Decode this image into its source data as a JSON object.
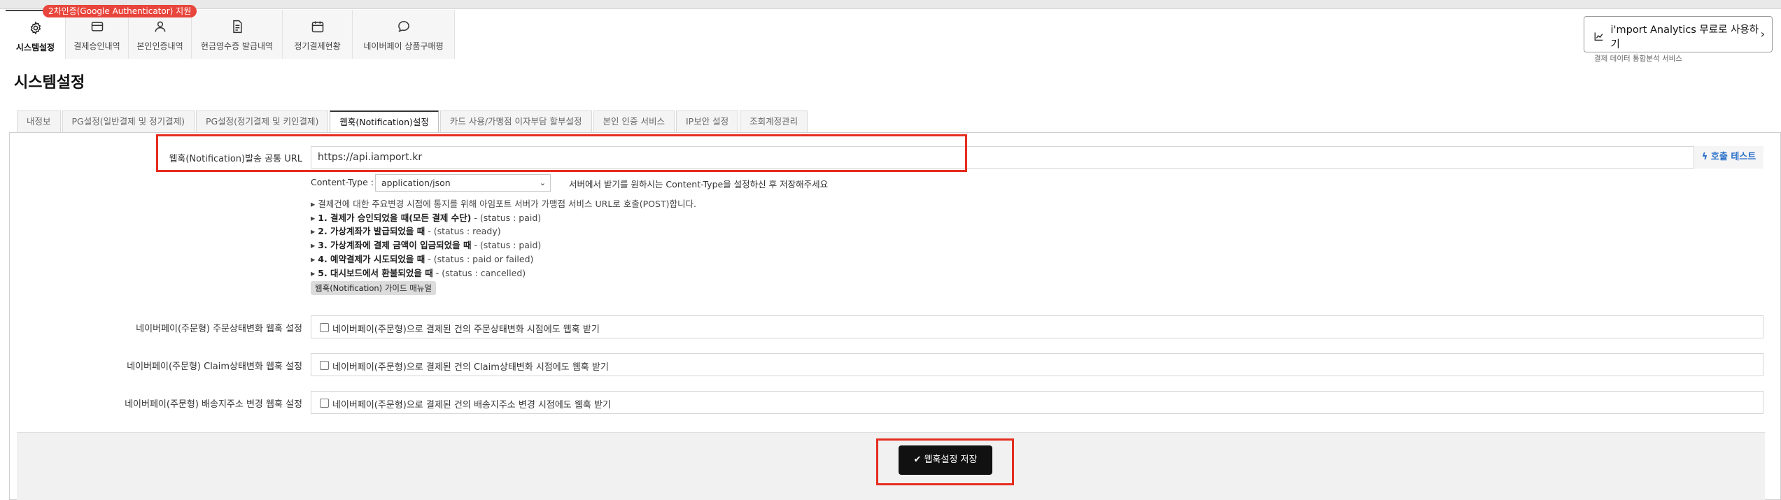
{
  "badge": "2차인증(Google Authenticator) 지원",
  "nav": [
    {
      "icon": "gear-icon",
      "label": "시스템설정",
      "active": true
    },
    {
      "icon": "card-icon",
      "label": "결제승인내역",
      "active": false
    },
    {
      "icon": "user-icon",
      "label": "본인인증내역",
      "active": false
    },
    {
      "icon": "receipt-icon",
      "label": "현금영수증 발급내역",
      "active": false
    },
    {
      "icon": "calendar-icon",
      "label": "정기결제현황",
      "active": false
    },
    {
      "icon": "chat-icon",
      "label": "네이버페이 상품구매평",
      "active": false
    }
  ],
  "promo": {
    "title": "i'mport Analytics 무료로 사용하기",
    "subtitle": "결제 데이터 통합분석 서비스",
    "icon": "chart-line-icon"
  },
  "page_title": "시스템설정",
  "tabs": [
    {
      "label": "내정보",
      "active": false
    },
    {
      "label": "PG설정(일반결제 및 정기결제)",
      "active": false
    },
    {
      "label": "PG설정(정기결제 및 키인결제)",
      "active": false
    },
    {
      "label": "웹훅(Notification)설정",
      "active": true
    },
    {
      "label": "카드 사용/가맹점 이자부담 할부설정",
      "active": false
    },
    {
      "label": "본인 인증 서비스",
      "active": false
    },
    {
      "label": "IP보안 설정",
      "active": false
    },
    {
      "label": "조회계정관리",
      "active": false
    }
  ],
  "webhook": {
    "url_label": "웹훅(Notification)발송 공통 URL",
    "url_value": "https://api.iamport.kr",
    "test_button": "호출 테스트",
    "content_type_label": "Content-Type :",
    "content_type_value": "application/json",
    "content_type_help": "서버에서 받기를 원하시는 Content-Type을 설정하신 후 저장해주세요",
    "bullets": [
      {
        "bold": "",
        "text": "결제건에 대한 주요변경 시점에 통지를 위해 아임포트 서버가 가맹점 서비스 URL로 호출(POST)합니다."
      },
      {
        "bold": "1. 결제가 승인되었을 때(모든 결제 수단)",
        "text": " - (status : paid)"
      },
      {
        "bold": "2. 가상계좌가 발급되었을 때",
        "text": " - (status : ready)"
      },
      {
        "bold": "3. 가상계좌에 결제 금액이 입금되었을 때",
        "text": " - (status : paid)"
      },
      {
        "bold": "4. 예약결제가 시도되었을 때",
        "text": " - (status : paid or failed)"
      },
      {
        "bold": "5. 대시보드에서 환불되었을 때",
        "text": " - (status : cancelled)"
      }
    ],
    "guide_button": "웹훅(Notification) 가이드 매뉴얼"
  },
  "naver": {
    "order_label": "네이버페이(주문형) 주문상태변화 웹훅 설정",
    "order_check": "네이버페이(주문형)으로 결제된 건의 주문상태변화 시점에도 웹훅 받기",
    "claim_label": "네이버페이(주문형) Claim상태변화 웹훅 설정",
    "claim_check": "네이버페이(주문형)으로 결제된 건의 Claim상태변화 시점에도 웹훅 받기",
    "address_label": "네이버페이(주문형) 배송지주소 변경 웹훅 설정",
    "address_check": "네이버페이(주문형)으로 결제된 건의 배송지주소 변경 시점에도 웹훅 받기"
  },
  "save_button": "웹훅설정 저장",
  "colors": {
    "highlight": "#e52d1f",
    "badge": "#e8453c",
    "link": "#2a6fc9",
    "save": "#111111"
  }
}
